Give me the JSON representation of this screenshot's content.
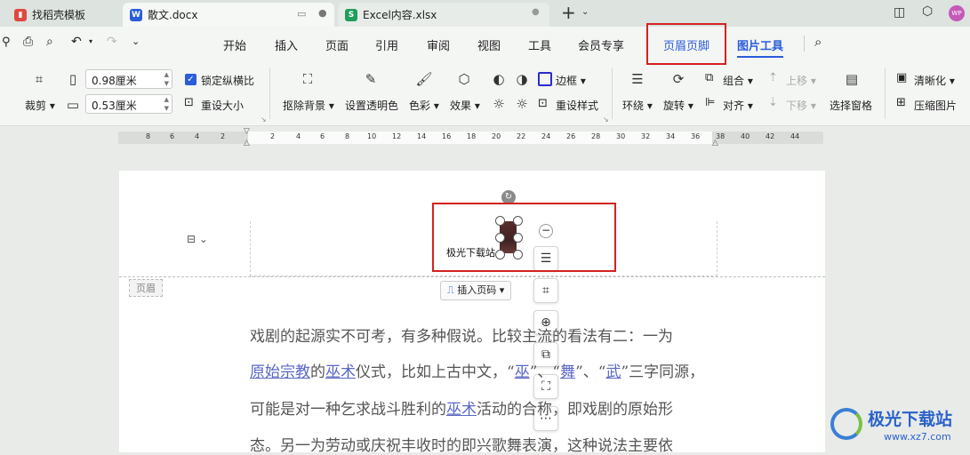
{
  "tabs": [
    {
      "label": "找稻壳模板",
      "icon_color": "#e0483e",
      "icon_letter": "稻"
    },
    {
      "label": "散文.docx",
      "icon_color": "#2b5ddb",
      "icon_letter": "W"
    },
    {
      "label": "Excel内容.xlsx",
      "icon_color": "#1f9e5c",
      "icon_letter": "S"
    }
  ],
  "menu": [
    "开始",
    "插入",
    "页面",
    "引用",
    "审阅",
    "视图",
    "工具",
    "会员专享",
    "页眉页脚",
    "图片工具"
  ],
  "ribbon": {
    "crop": "裁剪",
    "width_value": "0.98厘米",
    "height_value": "0.53厘米",
    "lock_ratio": "锁定纵横比",
    "reset_size": "重设大小",
    "remove_bg": "抠除背景",
    "set_transparent": "设置透明色",
    "color": "色彩",
    "effect": "效果",
    "border": "边框",
    "reset_style": "重设样式",
    "wrap": "环绕",
    "rotate": "旋转",
    "group": "组合",
    "align": "对齐",
    "move_up": "上移",
    "move_down": "下移",
    "selection_pane": "选择窗格",
    "sharpen": "清晰化",
    "compress": "压缩图片"
  },
  "ruler_numbers": [
    "8",
    "6",
    "4",
    "2",
    "2",
    "4",
    "6",
    "8",
    "10",
    "12",
    "14",
    "16",
    "18",
    "20",
    "22",
    "24",
    "26",
    "28",
    "30",
    "32",
    "34",
    "36",
    "38",
    "40",
    "42",
    "44"
  ],
  "document": {
    "header_tag": "页眉",
    "insert_page_number": "插入页码",
    "header_text": "极光下载站",
    "body_lines": [
      [
        "戏剧的起源实不可考，有多种假说。比较主流的看法有二：一为"
      ],
      [
        "原始宗教",
        "的",
        "巫术",
        "仪式，比如上古中文，“",
        "巫",
        "”、“",
        "舞",
        "”、“",
        "武",
        "”三字同源，"
      ],
      [
        "可能是对一种乞求战斗胜利的",
        "巫术",
        "活动的合称，即戏剧的原始形"
      ],
      [
        "态。另一为劳动或庆祝丰收时的即兴歌舞表演，这种说法主要依"
      ]
    ]
  },
  "watermark": {
    "title": "极光下载站",
    "url": "www.xz7.com"
  },
  "colors": {
    "accent": "#2b5ddb",
    "highlight_red": "#d32222",
    "link": "#5a67c4"
  }
}
